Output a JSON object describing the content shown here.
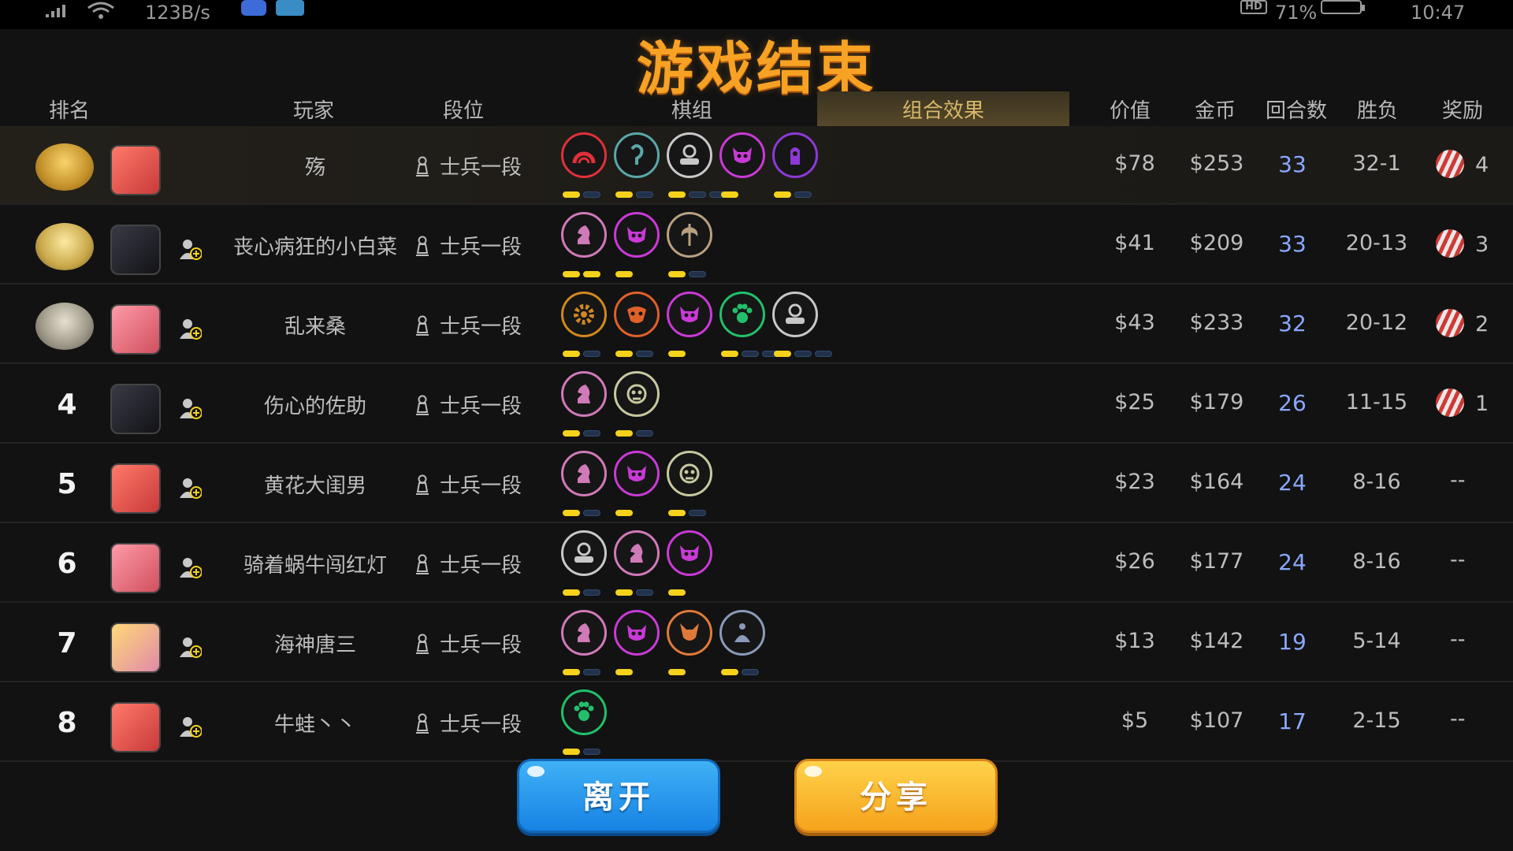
{
  "status_bar": {
    "speed": "123B/s",
    "battery": "71%",
    "time": "10:47",
    "hd": "HD"
  },
  "title": "游戏结束",
  "header": {
    "rank": "排名",
    "player": "玩家",
    "tier": "段位",
    "pieces": "棋组",
    "synergy": "组合效果",
    "value": "价值",
    "gold": "金币",
    "rounds": "回合数",
    "winloss": "胜负",
    "reward": "奖励"
  },
  "colors": {
    "title": "#f7a224",
    "rounds": "#8aa8ff",
    "pip_on": "#f5d21b",
    "leave": "#1783e4",
    "share": "#f5a31c"
  },
  "rows": [
    {
      "rank": "",
      "medal": "gold-medal",
      "avatar": "red-dragon",
      "name": "殇",
      "tier": "士兵一段",
      "value": "$78",
      "gold": "$253",
      "rounds": "33",
      "winloss": "32-1",
      "reward": "4",
      "synergies": [
        {
          "icon": "arch-icon",
          "color": "#e0303a",
          "pips": [
            1,
            0
          ]
        },
        {
          "icon": "spirit-icon",
          "color": "#5aa7a9",
          "pips": [
            1,
            0
          ]
        },
        {
          "icon": "robot-icon",
          "color": "#c8c8c8",
          "pips": [
            1,
            0,
            0
          ]
        },
        {
          "icon": "demon-icon",
          "color": "#c93ad6",
          "pips": [
            1
          ]
        },
        {
          "icon": "hand-icon",
          "color": "#8b3ad6",
          "pips": [
            1,
            0
          ]
        }
      ]
    },
    {
      "rank": "",
      "medal": "silver-medal",
      "avatar": "ninja",
      "name": "丧心病狂的小白菜",
      "tier": "士兵一段",
      "value": "$41",
      "gold": "$209",
      "rounds": "33",
      "winloss": "20-13",
      "reward": "3",
      "synergies": [
        {
          "icon": "knight-icon",
          "color": "#d07ab8",
          "pips": [
            1,
            1
          ]
        },
        {
          "icon": "demon-icon",
          "color": "#c93ad6",
          "pips": [
            1
          ]
        },
        {
          "icon": "axe-icon",
          "color": "#b8a080",
          "pips": [
            1,
            0
          ]
        }
      ]
    },
    {
      "rank": "",
      "medal": "bronze-medal",
      "avatar": "pink-dragon",
      "name": "乱来桑",
      "tier": "士兵一段",
      "value": "$43",
      "gold": "$233",
      "rounds": "32",
      "winloss": "20-12",
      "reward": "2",
      "synergies": [
        {
          "icon": "gear-icon",
          "color": "#d08820",
          "pips": [
            1,
            0
          ]
        },
        {
          "icon": "orc-icon",
          "color": "#e0602a",
          "pips": [
            1,
            0
          ]
        },
        {
          "icon": "demon-icon",
          "color": "#c93ad6",
          "pips": [
            1
          ]
        },
        {
          "icon": "paw-icon",
          "color": "#22c06a",
          "pips": [
            1,
            0,
            0
          ]
        },
        {
          "icon": "robot-icon",
          "color": "#c8c8c8",
          "pips": [
            1,
            0,
            0
          ]
        }
      ]
    },
    {
      "rank": "4",
      "medal": "",
      "avatar": "ninja",
      "name": "伤心的佐助",
      "tier": "士兵一段",
      "value": "$25",
      "gold": "$179",
      "rounds": "26",
      "winloss": "11-15",
      "reward": "1",
      "synergies": [
        {
          "icon": "knight-icon",
          "color": "#d07ab8",
          "pips": [
            1,
            0
          ]
        },
        {
          "icon": "goblin-icon",
          "color": "#c8c8a0",
          "pips": [
            1,
            0
          ]
        }
      ]
    },
    {
      "rank": "5",
      "medal": "",
      "avatar": "red-dragon",
      "name": "黄花大闺男",
      "tier": "士兵一段",
      "value": "$23",
      "gold": "$164",
      "rounds": "24",
      "winloss": "8-16",
      "reward": "--",
      "synergies": [
        {
          "icon": "knight-icon",
          "color": "#d07ab8",
          "pips": [
            1,
            0
          ]
        },
        {
          "icon": "demon-icon",
          "color": "#c93ad6",
          "pips": [
            1
          ]
        },
        {
          "icon": "goblin-icon",
          "color": "#c8c8a0",
          "pips": [
            1,
            0
          ]
        }
      ]
    },
    {
      "rank": "6",
      "medal": "",
      "avatar": "pink-dragon",
      "name": "骑着蜗牛闯红灯",
      "tier": "士兵一段",
      "value": "$26",
      "gold": "$177",
      "rounds": "24",
      "winloss": "8-16",
      "reward": "--",
      "synergies": [
        {
          "icon": "robot-icon",
          "color": "#c8c8c8",
          "pips": [
            1,
            0
          ]
        },
        {
          "icon": "knight-icon",
          "color": "#d07ab8",
          "pips": [
            1,
            0
          ]
        },
        {
          "icon": "demon-icon",
          "color": "#c93ad6",
          "pips": [
            1
          ]
        }
      ]
    },
    {
      "rank": "7",
      "medal": "",
      "avatar": "blonde-girl",
      "name": "海神唐三",
      "tier": "士兵一段",
      "value": "$13",
      "gold": "$142",
      "rounds": "19",
      "winloss": "5-14",
      "reward": "--",
      "synergies": [
        {
          "icon": "knight-icon",
          "color": "#d07ab8",
          "pips": [
            1,
            0
          ]
        },
        {
          "icon": "demon-icon",
          "color": "#c93ad6",
          "pips": [
            1
          ]
        },
        {
          "icon": "fox-icon",
          "color": "#e07a3a",
          "pips": [
            1
          ]
        },
        {
          "icon": "monk-icon",
          "color": "#8a9ab8",
          "pips": [
            1,
            0
          ]
        }
      ]
    },
    {
      "rank": "8",
      "medal": "",
      "avatar": "red-dragon",
      "name": "牛蛙丶丶",
      "tier": "士兵一段",
      "value": "$5",
      "gold": "$107",
      "rounds": "17",
      "winloss": "2-15",
      "reward": "--",
      "synergies": [
        {
          "icon": "paw-icon",
          "color": "#22c06a",
          "pips": [
            1,
            0
          ]
        }
      ]
    }
  ],
  "buttons": {
    "leave": "离开",
    "share": "分享"
  }
}
